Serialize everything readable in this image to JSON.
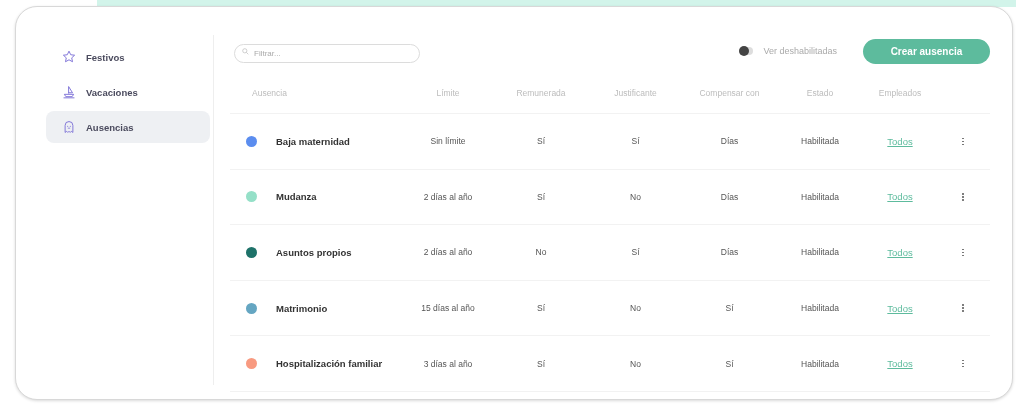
{
  "sidebar": {
    "items": [
      {
        "label": "Festivos",
        "selected": false
      },
      {
        "label": "Vacaciones",
        "selected": false
      },
      {
        "label": "Ausencias",
        "selected": true
      }
    ]
  },
  "filter": {
    "placeholder": "Filtrar..."
  },
  "toggle": {
    "label": "Ver deshabilitadas",
    "on": false
  },
  "create_button": "Crear ausencia",
  "table": {
    "columns": [
      "Ausencia",
      "Límite",
      "Remunerada",
      "Justificante",
      "Compensar con",
      "Estado",
      "Empleados"
    ],
    "rows": [
      {
        "color": "#5b8def",
        "name": "Baja maternidad",
        "limit": "Sin límite",
        "paid": "Sí",
        "document": "Sí",
        "compensate": "Días",
        "status": "Habilitada",
        "employees": "Todos"
      },
      {
        "color": "#95e0c8",
        "name": "Mudanza",
        "limit": "2 días al año",
        "paid": "Sí",
        "document": "No",
        "compensate": "Días",
        "status": "Habilitada",
        "employees": "Todos"
      },
      {
        "color": "#1e7269",
        "name": "Asuntos propios",
        "limit": "2 días al año",
        "paid": "No",
        "document": "Sí",
        "compensate": "Días",
        "status": "Habilitada",
        "employees": "Todos"
      },
      {
        "color": "#65a6c2",
        "name": "Matrimonio",
        "limit": "15 días al año",
        "paid": "Sí",
        "document": "No",
        "compensate": "Sí",
        "status": "Habilitada",
        "employees": "Todos"
      },
      {
        "color": "#f89a80",
        "name": "Hospitalización familiar",
        "limit": "3 días al año",
        "paid": "Sí",
        "document": "No",
        "compensate": "Sí",
        "status": "Habilitada",
        "employees": "Todos"
      }
    ]
  }
}
